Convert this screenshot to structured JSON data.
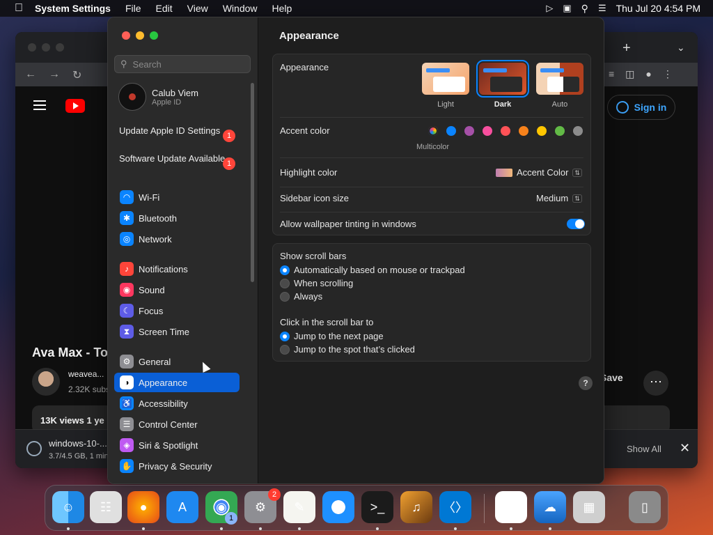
{
  "menubar": {
    "app_name": "System Settings",
    "menus": [
      "File",
      "Edit",
      "View",
      "Window",
      "Help"
    ],
    "clock": "Thu Jul 20  4:54 PM"
  },
  "browser": {
    "signin_label": "Sign in",
    "video_title": "Ava Max - To",
    "channel_name": "weavea...",
    "subscribers": "2.32K subs",
    "views": "13K views  1 ye",
    "save_label": "Save",
    "download_name": "windows-10-...",
    "download_meta": "3.7/4.5 GB, 1 min",
    "show_all": "Show All"
  },
  "settings": {
    "search_placeholder": "Search",
    "profile": {
      "name": "Calub Viem",
      "sub": "Apple ID"
    },
    "alerts": [
      {
        "label": "Update Apple ID Settings",
        "badge": "1"
      },
      {
        "label": "Software Update Available",
        "badge": "1"
      }
    ],
    "nav": [
      {
        "label": "Wi-Fi",
        "color": "#0a84ff",
        "icon": "wifi-icon"
      },
      {
        "label": "Bluetooth",
        "color": "#0a84ff",
        "icon": "bluetooth-icon"
      },
      {
        "label": "Network",
        "color": "#0a84ff",
        "icon": "globe-icon"
      },
      {
        "label": "Notifications",
        "color": "#ff453a",
        "icon": "bell-icon"
      },
      {
        "label": "Sound",
        "color": "#ff375f",
        "icon": "speaker-icon"
      },
      {
        "label": "Focus",
        "color": "#5e5ce6",
        "icon": "moon-icon"
      },
      {
        "label": "Screen Time",
        "color": "#5e5ce6",
        "icon": "hourglass-icon"
      },
      {
        "label": "General",
        "color": "#8e8e93",
        "icon": "gear-icon"
      },
      {
        "label": "Appearance",
        "color": "#1c1c1e",
        "icon": "appearance-icon",
        "active": true
      },
      {
        "label": "Accessibility",
        "color": "#0a84ff",
        "icon": "accessibility-icon"
      },
      {
        "label": "Control Center",
        "color": "#8e8e93",
        "icon": "control-center-icon"
      },
      {
        "label": "Siri & Spotlight",
        "color": "#bf5af2",
        "icon": "siri-icon"
      },
      {
        "label": "Privacy & Security",
        "color": "#0a84ff",
        "icon": "hand-icon"
      }
    ],
    "content_title": "Appearance",
    "appearance_label": "Appearance",
    "modes": [
      {
        "label": "Light",
        "selected": false
      },
      {
        "label": "Dark",
        "selected": true
      },
      {
        "label": "Auto",
        "selected": false
      }
    ],
    "accent_label": "Accent color",
    "accent_colors": [
      "multicolor",
      "#0a84ff",
      "#a550a7",
      "#f74f9e",
      "#ff5257",
      "#f7821b",
      "#ffc600",
      "#62ba46",
      "#8c8c8c"
    ],
    "multicolor_caption": "Multicolor",
    "highlight_label": "Highlight color",
    "highlight_value": "Accent Color",
    "sidebar_icon_label": "Sidebar icon size",
    "sidebar_icon_value": "Medium",
    "tinting_label": "Allow wallpaper tinting in windows",
    "tinting_on": true,
    "scrollbars_label": "Show scroll bars",
    "scrollbar_options": [
      {
        "label": "Automatically based on mouse or trackpad",
        "checked": true
      },
      {
        "label": "When scrolling",
        "checked": false
      },
      {
        "label": "Always",
        "checked": false
      }
    ],
    "click_label": "Click in the scroll bar to",
    "click_options": [
      {
        "label": "Jump to the next page",
        "checked": true
      },
      {
        "label": "Jump to the spot that’s clicked",
        "checked": false
      }
    ],
    "help": "?"
  },
  "dock": {
    "apps": [
      "Finder",
      "Launchpad",
      "Firefox",
      "App Store",
      "Chrome",
      "System Settings",
      "TextEdit",
      "Safari",
      "Terminal",
      "GarageBand",
      "VS Code",
      "Visual Studio",
      "Weather",
      "Boot Camp",
      "Trash"
    ],
    "chrome_badge": "1",
    "settings_badge": "2"
  }
}
